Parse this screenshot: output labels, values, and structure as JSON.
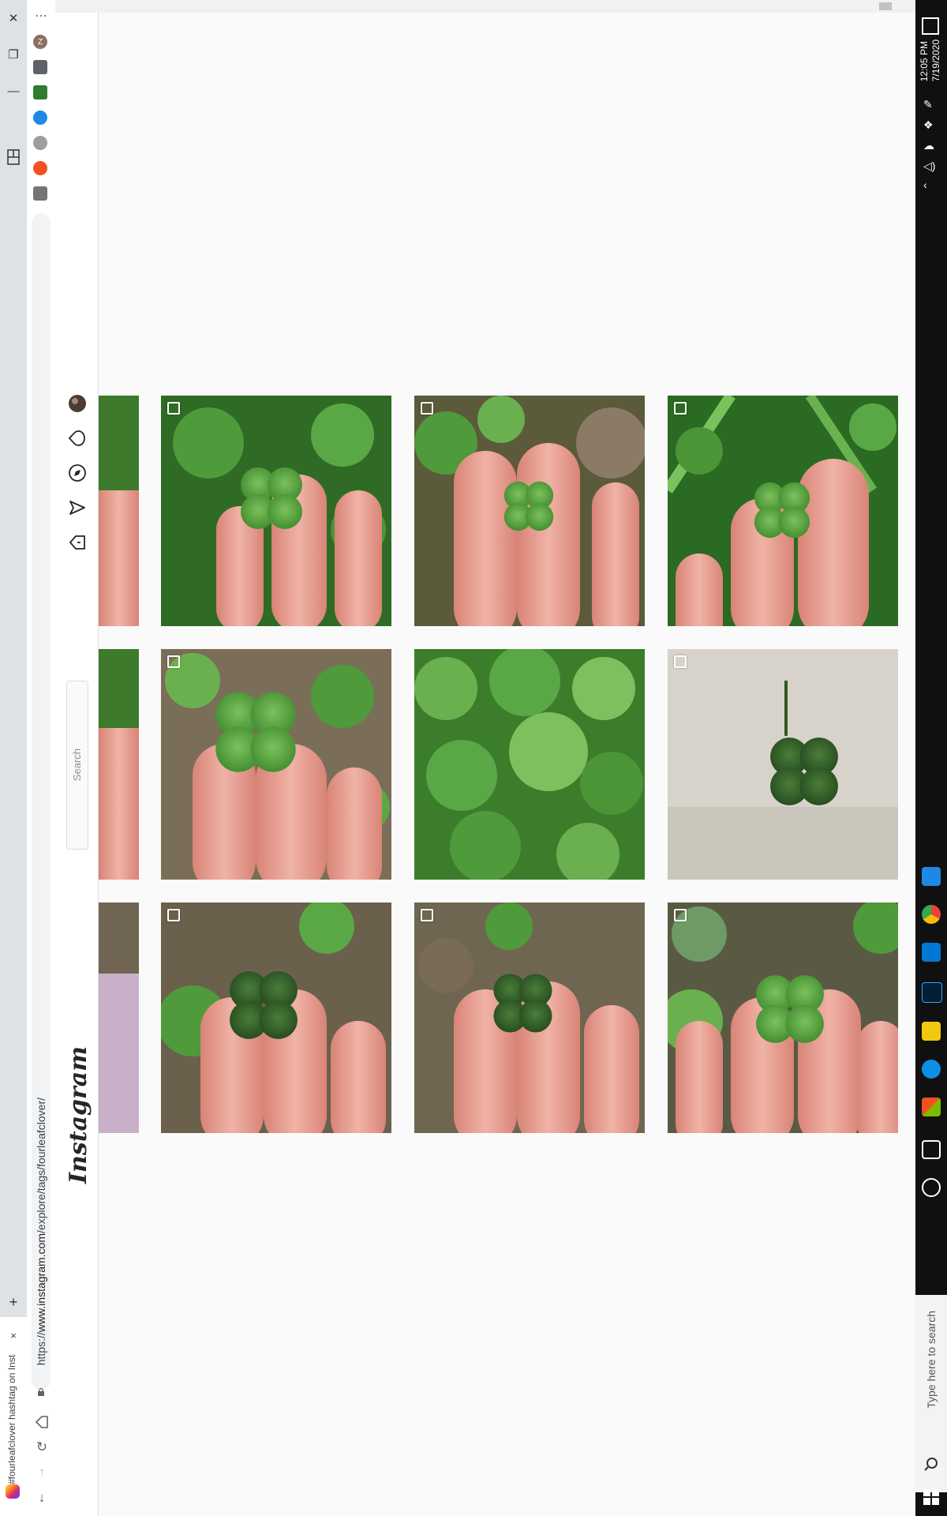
{
  "browser": {
    "tab_title": "#fourleafclover hashtag on Insta…",
    "url_prefix": "https://",
    "url_host": "www.instagram.com",
    "url_path": "/explore/tags/fourleafclover/",
    "new_tab_symbol": "+",
    "close_symbol": "×",
    "menu_symbol": "⋯",
    "profile_initial": "Z"
  },
  "instagram": {
    "logo_text": "Instagram",
    "search_placeholder": "Search",
    "nav_icons": [
      "home-icon",
      "direct-icon",
      "explore-icon",
      "activity-heart-icon",
      "profile-avatar"
    ]
  },
  "grid": {
    "rows": 3,
    "visible_columns": 3,
    "multi_indicator_tiles": [
      0,
      1,
      2,
      3,
      5,
      6,
      7,
      8
    ]
  },
  "taskbar": {
    "time": "12:05 PM",
    "date": "7/19/2020",
    "search_placeholder": "Type here to search"
  },
  "colors": {
    "ig_background": "#fafafa",
    "taskbar": "#101010",
    "leaf_green": "#4f9a3a",
    "skin": "#e39a8e"
  }
}
